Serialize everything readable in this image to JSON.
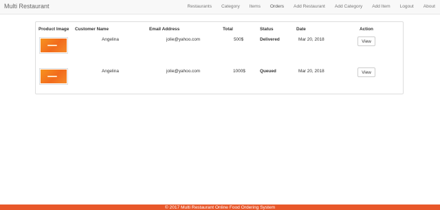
{
  "navbar": {
    "brand": "Multi Restaurant",
    "items": [
      "Restaurants",
      "Category",
      "Items",
      "Orders",
      "Add Restaurant",
      "Add Category",
      "Add Item",
      "Logout",
      "About"
    ],
    "active": "Orders"
  },
  "table": {
    "headers": [
      "Product Image",
      "Customer Name",
      "Email Address",
      "Total",
      "Status",
      "Date",
      "Action"
    ],
    "rows": [
      {
        "customer": "Angelina",
        "email": "jolie@yahoo.com",
        "total": "500$",
        "status": "Delivered",
        "date": "Mar 20, 2018",
        "action": "View"
      },
      {
        "customer": "Angelina",
        "email": "jolie@yahoo.com",
        "total": "1000$",
        "status": "Queued",
        "date": "Mar 20, 2018",
        "action": "View"
      }
    ]
  },
  "footer": {
    "text": "© 2017 Multi Restaurant Online Food Ordering System"
  },
  "colors": {
    "footer_bg": "#e8572a",
    "navbar_bg": "#f8f8f8",
    "thumb": "#f7931e"
  },
  "icons": {
    "product_image": "food-banner-image"
  }
}
